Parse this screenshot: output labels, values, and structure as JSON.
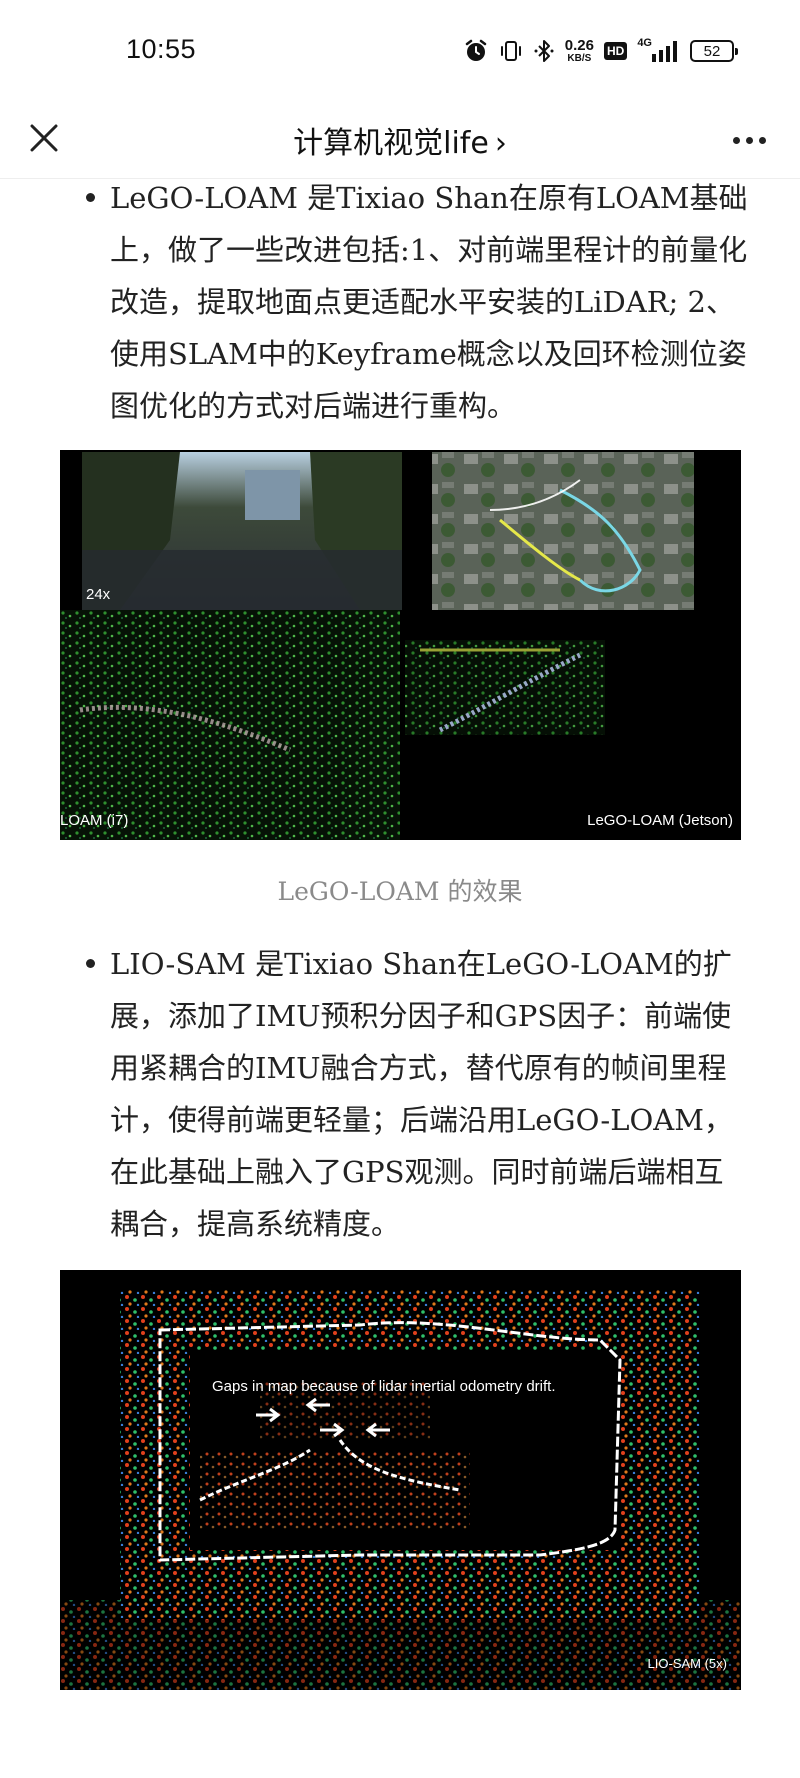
{
  "status": {
    "time": "10:55",
    "speed_value": "0.26",
    "speed_unit": "KB/S",
    "hd": "HD",
    "network": "4G",
    "battery": "52"
  },
  "nav": {
    "title": "计算机视觉life",
    "chevron": "›"
  },
  "article": {
    "bullet1": "LeGO-LOAM 是Tixiao Shan在原有LOAM基础上，做了一些改进包括:1、对前端里程计的前量化改造，提取地面点更适配水平安装的LiDAR; 2、使用SLAM中的Keyframe概念以及回环检测位姿图优化的方式对后端进行重构。",
    "figure1": {
      "speed_label": "24x",
      "left_label": "LOAM (i7)",
      "right_label": "LeGO-LOAM (Jetson)"
    },
    "caption1": "LeGO-LOAM  的效果",
    "bullet2": "LIO-SAM 是Tixiao Shan在LeGO-LOAM的扩展，添加了IMU预积分因子和GPS因子：前端使用紧耦合的IMU融合方式，替代原有的帧间里程计，使得前端更轻量；后端沿用LeGO-LOAM，在此基础上融入了GPS观测。同时前端后端相互耦合，提高系统精度。",
    "figure2": {
      "annotation": "Gaps in map because of lidar inertial odometry drift.",
      "corner_label": "LIO-SAM (5x)"
    }
  },
  "colors": {
    "text": "#222222",
    "caption": "#8a8a8a",
    "figure_bg": "#000000"
  }
}
